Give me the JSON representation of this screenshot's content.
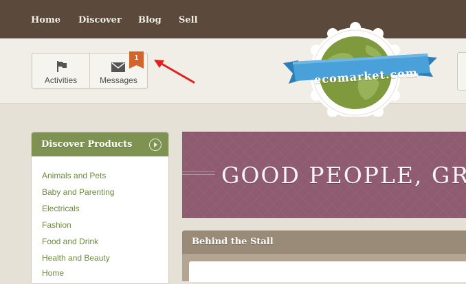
{
  "nav": {
    "items": [
      {
        "label": "Home"
      },
      {
        "label": "Discover"
      },
      {
        "label": "Blog"
      },
      {
        "label": "Sell"
      }
    ]
  },
  "header": {
    "activities_label": "Activities",
    "messages_label": "Messages",
    "messages_badge": "1",
    "logo_text": "ecomarket.com"
  },
  "sidebar": {
    "title": "Discover Products",
    "categories": [
      {
        "label": "Animals and Pets"
      },
      {
        "label": "Baby and Parenting"
      },
      {
        "label": "Electricals"
      },
      {
        "label": "Fashion"
      },
      {
        "label": "Food and Drink"
      },
      {
        "label": "Health and Beauty"
      },
      {
        "label": "Home"
      }
    ]
  },
  "hero": {
    "text": "GOOD PEOPLE, GRE"
  },
  "stall": {
    "title": "Behind the Stall"
  },
  "colors": {
    "nav_bg": "#5b4a3c",
    "sidebar_head": "#7e9251",
    "hero_bg": "#8e5b70",
    "badge": "#d2652a",
    "annotation_arrow": "#e0201f"
  }
}
